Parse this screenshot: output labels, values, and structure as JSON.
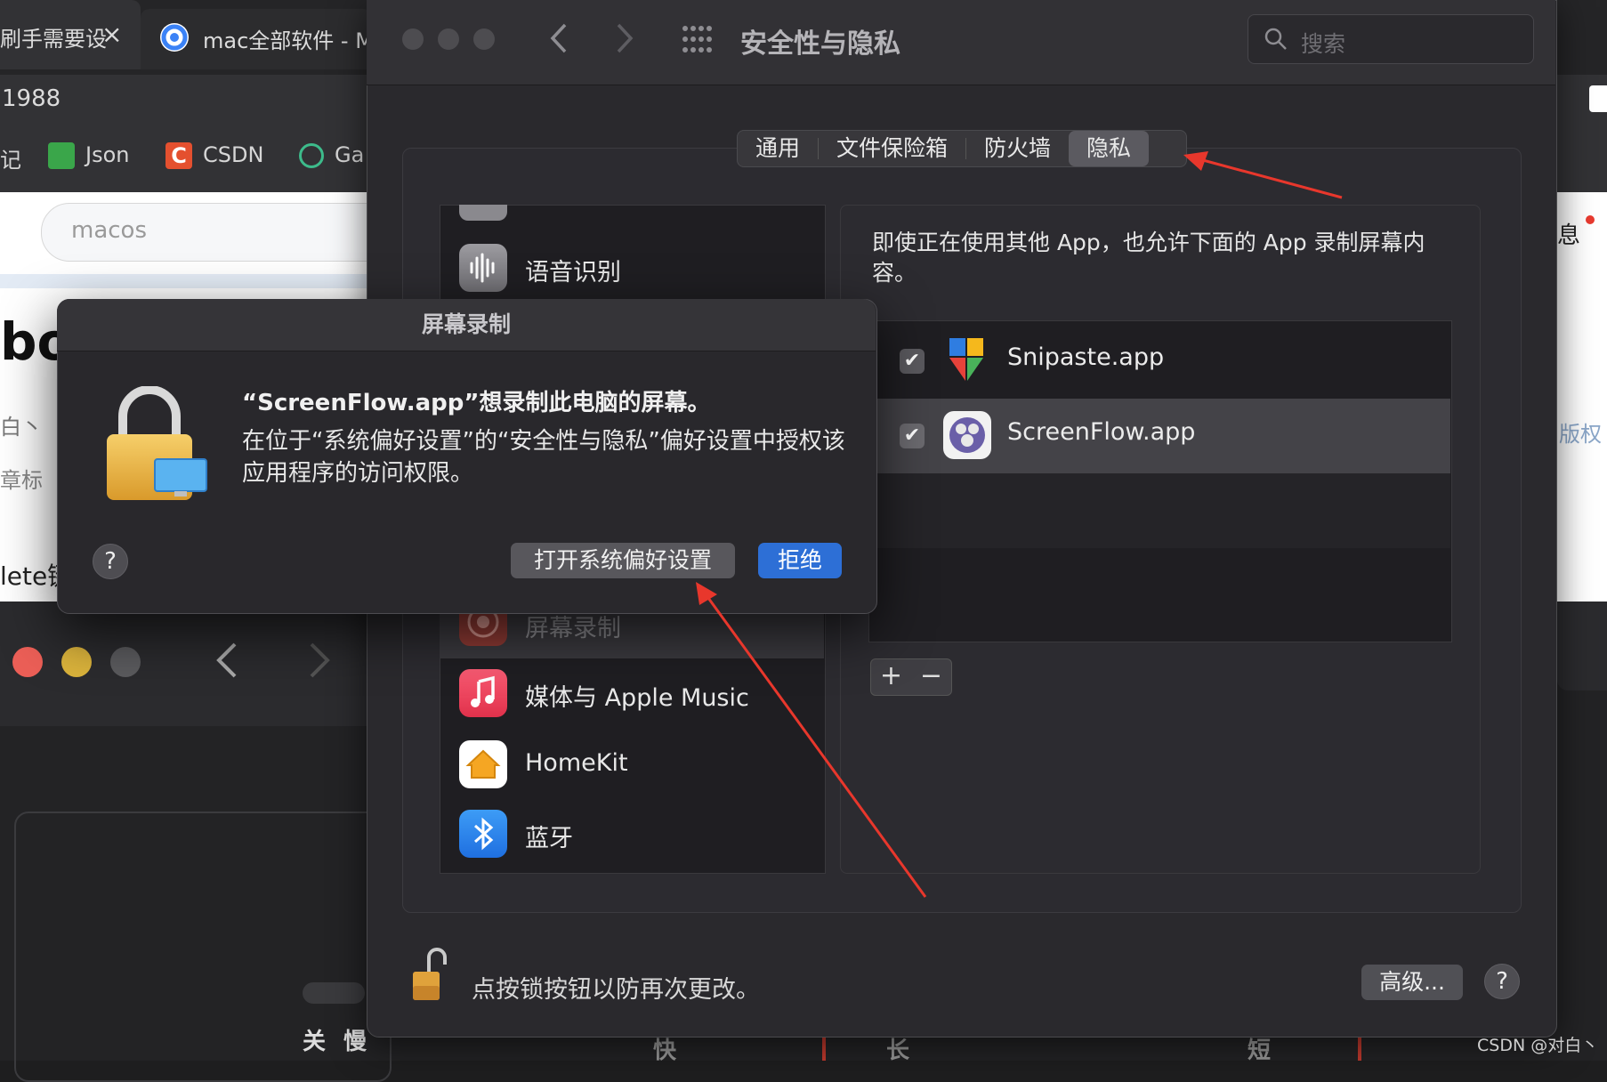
{
  "browser": {
    "tabs": [
      {
        "label": "刷手需要设",
        "close": "×"
      },
      {
        "label": "mac全部软件 - M"
      }
    ],
    "url_fragment": "1988",
    "bookmarks": [
      {
        "label": "记"
      },
      {
        "label": "Json"
      },
      {
        "label": "CSDN"
      },
      {
        "label": "Ga"
      }
    ],
    "search_value": "macos",
    "page_fragments": [
      "bo",
      "白丶",
      "章标",
      "lete键",
      "息",
      "版权"
    ]
  },
  "background_app": {
    "bottom_labels": [
      "关",
      "慢",
      "快",
      "长",
      "短"
    ]
  },
  "prefs": {
    "title": "安全性与隐私",
    "search_placeholder": "搜索",
    "tabs": [
      "通用",
      "文件保险箱",
      "防火墙",
      "隐私"
    ],
    "active_tab": "隐私",
    "left_items": [
      {
        "label": "语音识别",
        "icon": "waveform-icon"
      },
      {
        "label": "屏幕录制",
        "icon": "screen-record-icon"
      },
      {
        "label": "媒体与 Apple Music",
        "icon": "music-note-icon"
      },
      {
        "label": "HomeKit",
        "icon": "home-icon"
      },
      {
        "label": "蓝牙",
        "icon": "bluetooth-icon"
      }
    ],
    "description": "即使正在使用其他 App，也允许下面的 App 录制屏幕内容。",
    "apps": [
      {
        "name": "Snipaste.app",
        "checked": true
      },
      {
        "name": "ScreenFlow.app",
        "checked": true
      }
    ],
    "add_label": "+",
    "remove_label": "−",
    "lock_message": "点按锁按钮以防再次更改。",
    "advanced_label": "高级...",
    "help_label": "?"
  },
  "dialog": {
    "title": "屏幕录制",
    "heading": "“ScreenFlow.app”想录制此电脑的屏幕。",
    "body": "在位于“系统偏好设置”的“安全性与隐私”偏好设置中授权该应用程序的访问权限。",
    "help_label": "?",
    "open_label": "打开系统偏好设置",
    "deny_label": "拒绝"
  },
  "watermark": "CSDN @对白丶",
  "colors": {
    "accent_blue": "#2d6fd6",
    "arrow_red": "#e8372c",
    "close_red": "#ec5f57",
    "minimize_yellow": "#dcb43c"
  }
}
